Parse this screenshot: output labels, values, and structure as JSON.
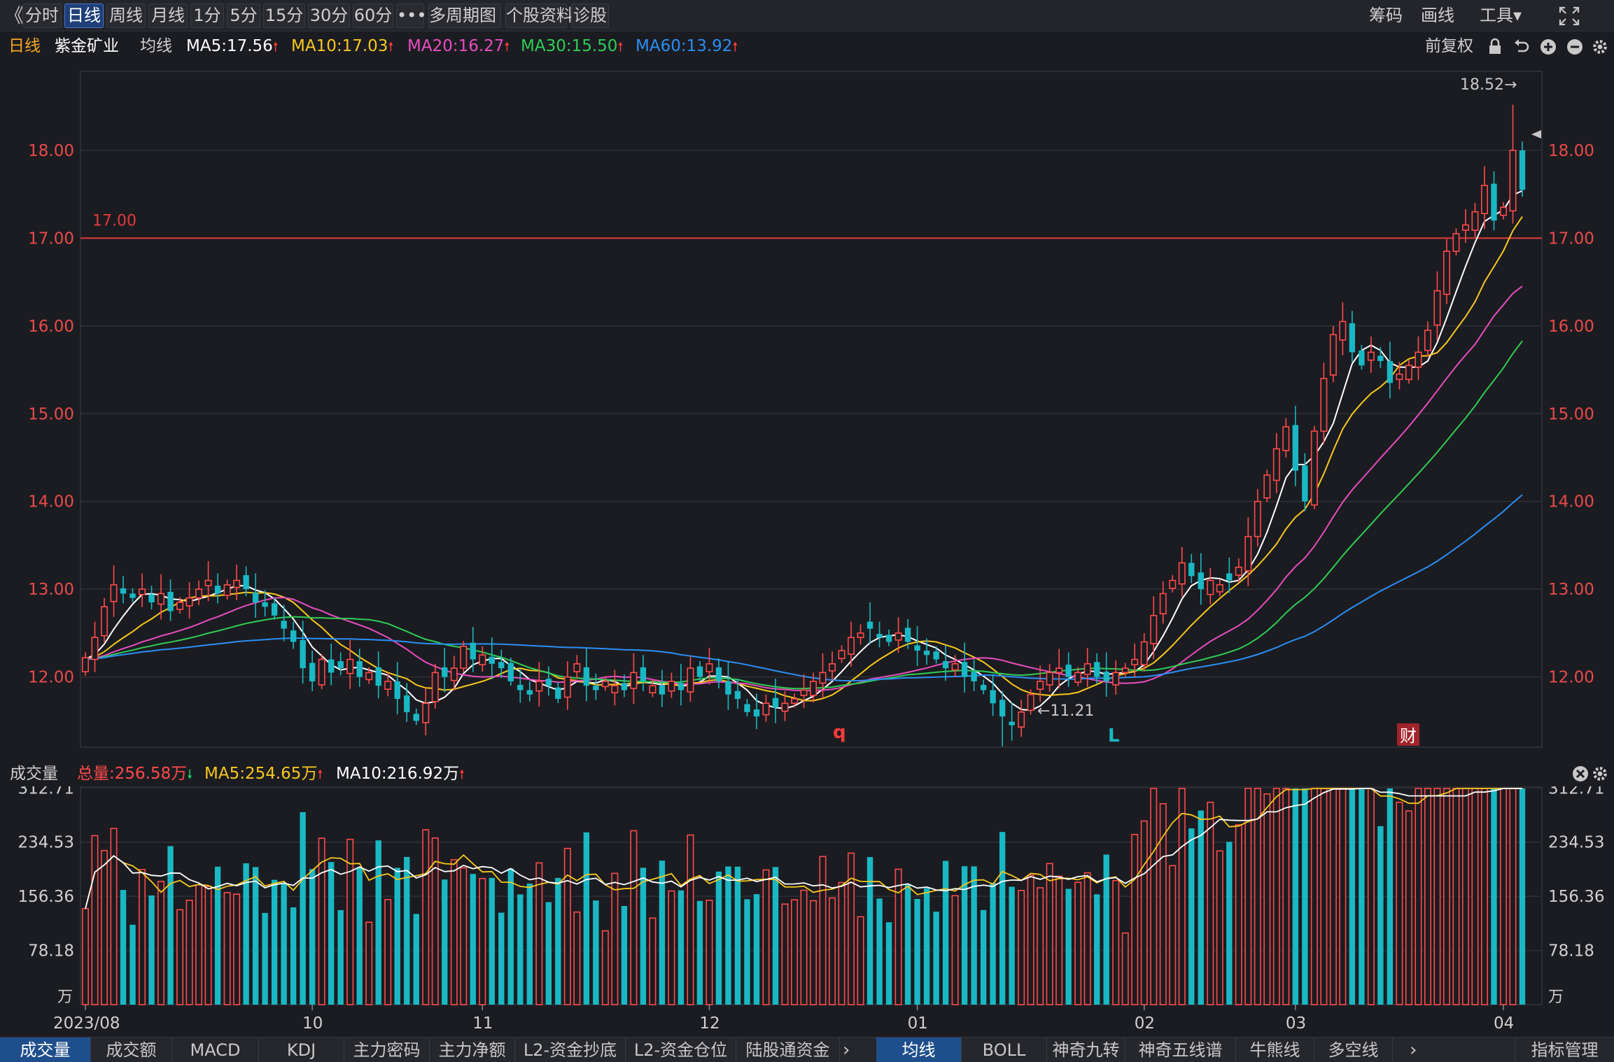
{
  "toolbar": {
    "back_label": "《",
    "periods": [
      "分时",
      "日线",
      "周线",
      "月线",
      "1分",
      "5分",
      "15分",
      "30分",
      "60分",
      "•••",
      "多周期图 ⌄",
      "个股资料",
      "诊股"
    ],
    "active_period": "日线",
    "right_items": [
      "筹码",
      "画线",
      "工具▾"
    ]
  },
  "info": {
    "period": "日线",
    "stock_name": "紫金矿业",
    "ma_label": "均线",
    "ma5": "MA5:17.56",
    "ma10": "MA10:17.03",
    "ma20": "MA20:16.27",
    "ma30": "MA30:15.50",
    "ma60": "MA60:13.92",
    "adjust": "前复权"
  },
  "colors": {
    "up": "#ff4a4a",
    "down": "#19b8c4",
    "ma5": "#ffffff",
    "ma10": "#f7c81e",
    "ma20": "#e94dc0",
    "ma30": "#2fcd55",
    "ma60": "#2a8ef5",
    "bg": "#1b1c21"
  },
  "price_chart": {
    "y_ticks": [
      "18.00",
      "17.00",
      "16.00",
      "15.00",
      "14.00",
      "13.00",
      "12.00"
    ],
    "ylim": [
      11.2,
      18.9
    ],
    "hline_value": 17.0,
    "hline_label": "17.00",
    "high_label": "18.52→",
    "low_label": "←11.21",
    "event_markers": [
      "q",
      "L",
      "财"
    ]
  },
  "volume": {
    "title": "成交量",
    "total": "总量:256.58万",
    "ma5": "MA5:254.65万",
    "ma10": "MA10:216.92万",
    "y_ticks": [
      "312.71",
      "234.53",
      "156.36",
      "78.18"
    ],
    "unit": "万",
    "ylim": [
      0,
      315
    ]
  },
  "x_axis": {
    "labels": [
      "2023/08",
      "10",
      "11",
      "12",
      "01",
      "02",
      "03",
      "04"
    ]
  },
  "bottom_tabs_left": [
    "成交量",
    "成交额",
    "MACD",
    "KDJ",
    "主力密码",
    "主力净额",
    "L2-资金抄底",
    "L2-资金仓位",
    "陆股通资金"
  ],
  "bottom_tabs_right": [
    "均线",
    "BOLL",
    "神奇九转",
    "神奇五线谱",
    "牛熊线",
    "多空线"
  ],
  "manage_label": "指标管理",
  "chart_data": {
    "type": "candlestick",
    "closes": [
      12.22,
      12.45,
      12.8,
      13.05,
      12.95,
      12.9,
      13.0,
      12.85,
      12.95,
      12.75,
      12.85,
      12.9,
      13.0,
      13.1,
      12.95,
      13.05,
      13.1,
      13.0,
      12.85,
      12.8,
      12.7,
      12.55,
      12.4,
      12.1,
      11.95,
      12.2,
      12.05,
      12.1,
      12.2,
      12.0,
      12.05,
      11.9,
      11.95,
      11.75,
      11.6,
      11.5,
      11.7,
      12.05,
      12.0,
      12.1,
      12.35,
      12.2,
      12.25,
      12.15,
      12.1,
      11.95,
      11.85,
      11.8,
      11.95,
      11.9,
      11.75,
      12.0,
      12.15,
      11.9,
      11.85,
      11.95,
      11.9,
      11.85,
      12.05,
      11.95,
      11.9,
      11.8,
      11.95,
      11.85,
      12.1,
      12.0,
      12.15,
      11.95,
      11.8,
      11.75,
      11.6,
      11.55,
      11.7,
      11.65,
      11.7,
      11.75,
      11.85,
      11.95,
      12.05,
      12.15,
      12.3,
      12.45,
      12.5,
      12.55,
      12.45,
      12.4,
      12.5,
      12.4,
      12.3,
      12.25,
      12.2,
      12.1,
      12.15,
      12.0,
      11.95,
      11.85,
      11.7,
      11.55,
      11.45,
      11.6,
      11.8,
      11.95,
      12.05,
      12.1,
      12.0,
      12.05,
      12.15,
      12.0,
      11.95,
      12.05,
      12.1,
      12.2,
      12.4,
      12.7,
      12.95,
      13.1,
      13.3,
      13.15,
      13.0,
      13.1,
      13.05,
      13.1,
      13.25,
      13.6,
      14.0,
      14.3,
      14.6,
      14.85,
      14.35,
      14.0,
      14.8,
      15.4,
      15.9,
      16.05,
      15.7,
      15.55,
      15.7,
      15.6,
      15.35,
      15.45,
      15.55,
      15.7,
      15.95,
      16.4,
      16.85,
      17.05,
      17.15,
      17.3,
      17.6,
      17.2,
      17.35,
      18.0,
      17.55
    ]
  }
}
